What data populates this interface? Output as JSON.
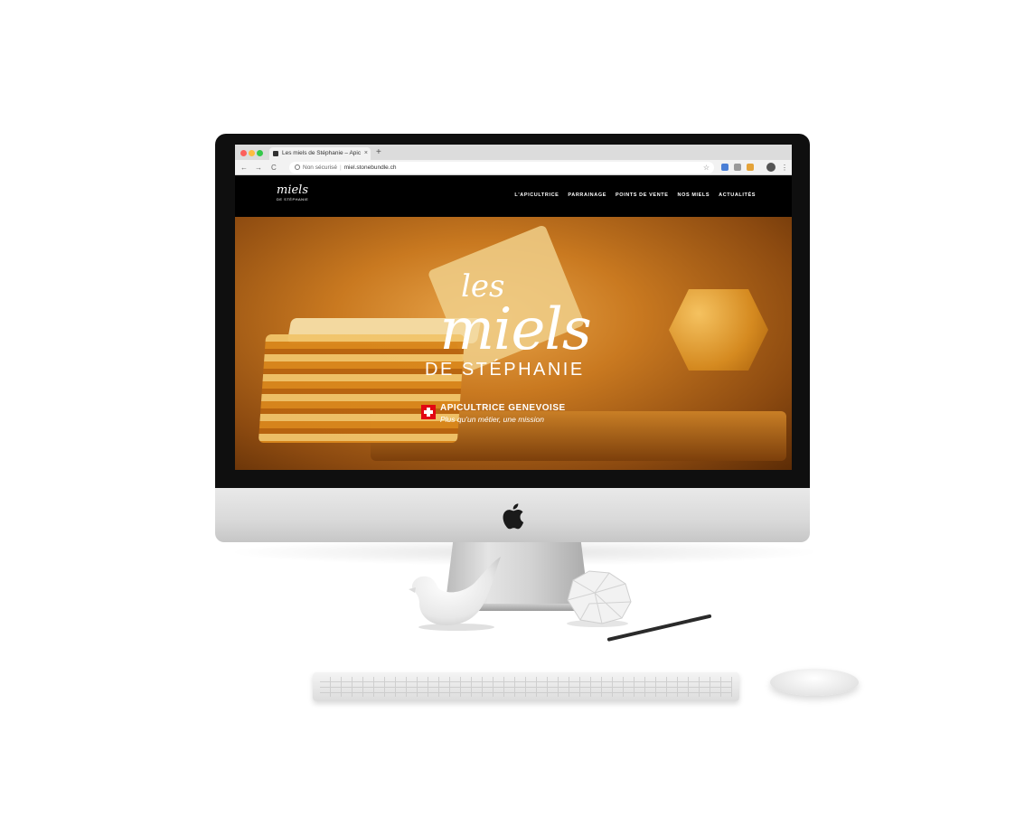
{
  "browser": {
    "tab_title": "Les miels de Stéphanie – Apic",
    "tab_close": "×",
    "new_tab": "+",
    "nav_back": "←",
    "nav_forward": "→",
    "nav_reload": "C",
    "security_label": "Non sécurisé",
    "separator": "|",
    "url": "miel.stonebundle.ch",
    "bookmark_icon": "star-icon",
    "menu_icon": "⋮"
  },
  "site": {
    "logo": {
      "script": "miels",
      "sub": "DE STÉPHANIE"
    },
    "nav": [
      {
        "label": "L'APICULTRICE"
      },
      {
        "label": "PARRAINAGE"
      },
      {
        "label": "POINTS DE VENTE"
      },
      {
        "label": "NOS MIELS"
      },
      {
        "label": "ACTUALITÉS"
      }
    ],
    "hero": {
      "les": "les",
      "miels": "miels",
      "de": "DE STÉPHANIE",
      "badge_title": "APICULTRICE GENEVOISE",
      "tagline": "Plus qu'un métier, une mission",
      "flag_icon": "swiss-flag-icon"
    }
  },
  "colors": {
    "honey": "#d58a20",
    "flag_red": "#e30613",
    "header_bg": "#000000"
  }
}
